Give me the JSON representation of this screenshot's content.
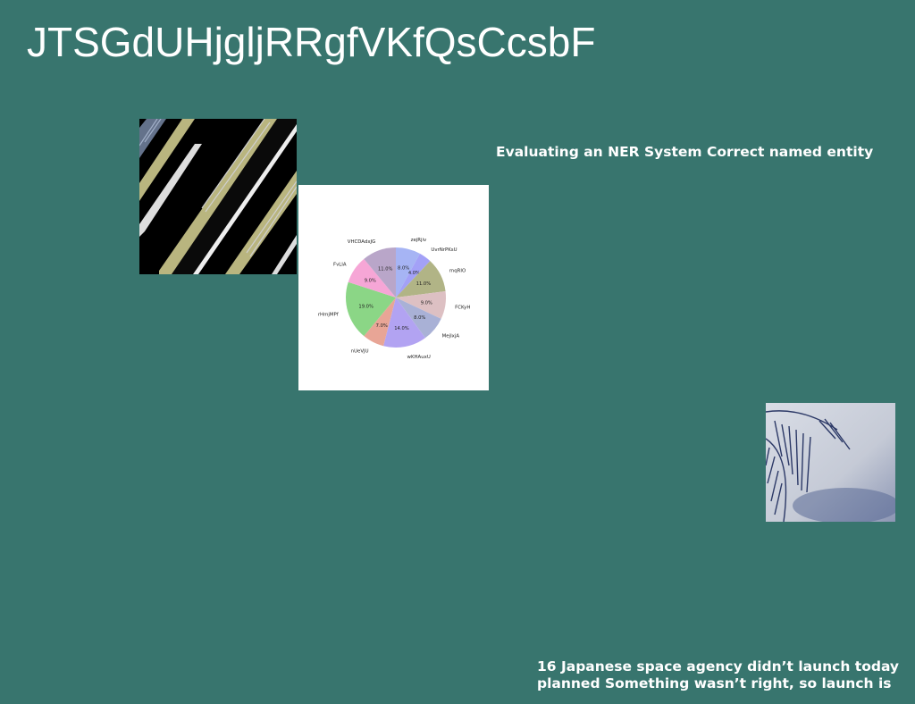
{
  "page": {
    "title": "JTSGdUHjgljRRgfVKfQsCcsbF",
    "background": "#38756e"
  },
  "captions": {
    "ner": "Evaluating an NER System Correct named entity",
    "news_line1": "16 Japanese space agency didn’t launch today",
    "news_line2": "planned Something wasn’t right, so launch is"
  },
  "images": {
    "building": "building-balconies-photo",
    "fern": "fern-leaves-photo"
  },
  "chart_data": {
    "type": "pie",
    "title": "",
    "series": [
      {
        "labels": [
          "zejRjiv",
          "UvrNrPKsU",
          "rnqRIO",
          "FCKyH",
          "MejIxjA",
          "wKHAuxU",
          "nUeVJU",
          "rHmjMPf",
          "FvLIA",
          "VHCDAdxJG"
        ],
        "values": [
          8.0,
          4.0,
          11.0,
          9.0,
          8.0,
          14.0,
          7.0,
          19.0,
          9.0,
          11.0
        ],
        "pct_labels": [
          "8.0%",
          "4.0%",
          "11.0%",
          "9.0%",
          "8.0%",
          "14.0%",
          "7.0%",
          "19.0%",
          "9.0%",
          "11.0%"
        ],
        "colors": [
          "#a6b4f4",
          "#a3a1f7",
          "#b1b486",
          "#ddc0c3",
          "#a9b1d6",
          "#b2a3f2",
          "#e8a596",
          "#8bd686",
          "#f6a6d6",
          "#b9a6c9"
        ]
      }
    ]
  }
}
